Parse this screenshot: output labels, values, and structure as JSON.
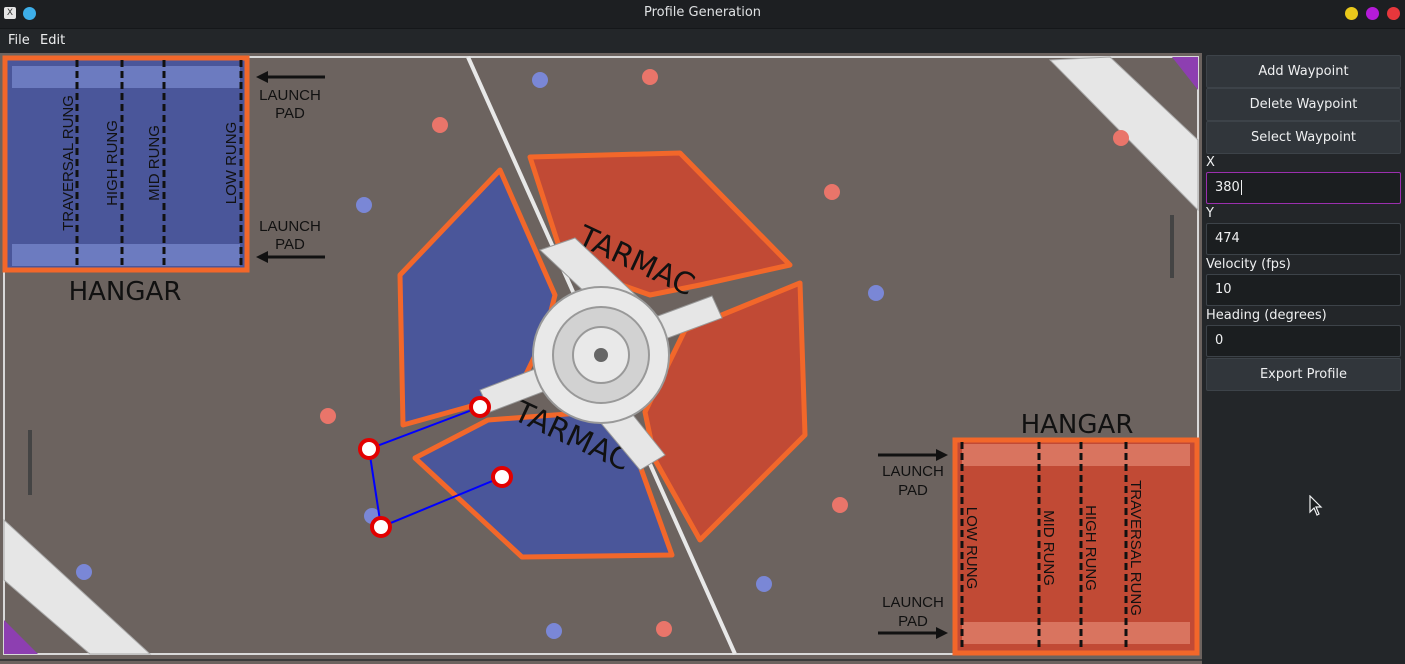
{
  "window": {
    "title": "Profile Generation",
    "app_icon": "X",
    "controls": [
      {
        "name": "minimize",
        "color": "#e9c81b"
      },
      {
        "name": "maximize",
        "color": "#b51bd9"
      },
      {
        "name": "close",
        "color": "#e7373c"
      }
    ]
  },
  "menu": {
    "file": "File",
    "edit": "Edit"
  },
  "field": {
    "hangar_left": {
      "title": "HANGAR",
      "rungs": [
        "TRAVERSAL RUNG",
        "HIGH RUNG",
        "MID RUNG",
        "LOW RUNG"
      ],
      "launch_pad_top": [
        "LAUNCH",
        "PAD"
      ],
      "launch_pad_bottom": [
        "LAUNCH",
        "PAD"
      ]
    },
    "hangar_right": {
      "title": "HANGAR",
      "rungs": [
        "LOW RUNG",
        "MID RUNG",
        "HIGH RUNG",
        "TRAVERSAL RUNG"
      ],
      "launch_pad_top": [
        "LAUNCH",
        "PAD"
      ],
      "launch_pad_bottom": [
        "LAUNCH",
        "PAD"
      ]
    },
    "tarmac_label": "TARMAC",
    "colors": {
      "carpet": "#6c635f",
      "blue": "#4a569a",
      "red": "#c14a35",
      "orange": "#f2672a",
      "path": "#0000ff",
      "waypoint": "#e20000"
    }
  },
  "sidebar": {
    "add_waypoint": "Add Waypoint",
    "delete_waypoint": "Delete Waypoint",
    "select_waypoint": "Select Waypoint",
    "x_label": "X",
    "x_value": "380",
    "y_label": "Y",
    "y_value": "474",
    "velocity_label": "Velocity (fps)",
    "velocity_value": "10",
    "heading_label": "Heading (degrees)",
    "heading_value": "0",
    "export_profile": "Export Profile"
  }
}
